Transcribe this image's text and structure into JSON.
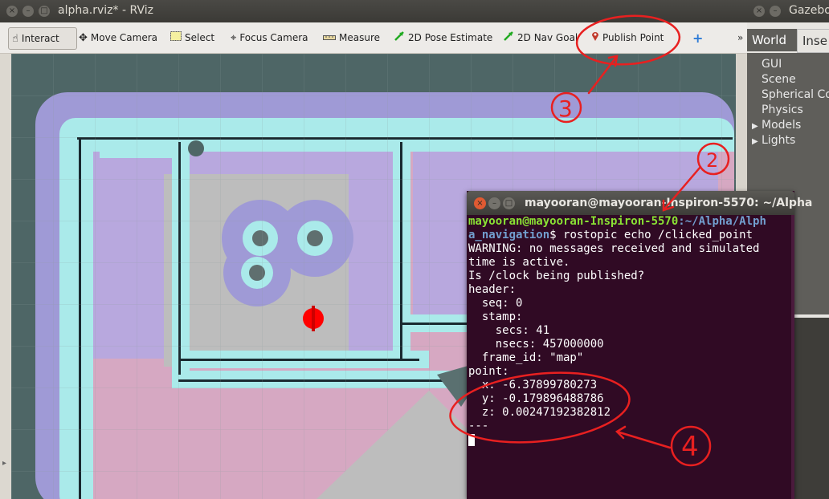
{
  "rviz": {
    "title": "alpha.rviz* - RViz",
    "toolbar": [
      {
        "label": "Interact",
        "icon": "hand-pointer-icon",
        "active": true
      },
      {
        "label": "Move Camera",
        "icon": "move-camera-icon"
      },
      {
        "label": "Select",
        "icon": "select-rectangle-icon"
      },
      {
        "label": "Focus Camera",
        "icon": "focus-camera-icon"
      },
      {
        "label": "Measure",
        "icon": "ruler-icon"
      },
      {
        "label": "2D Pose Estimate",
        "icon": "green-arrow-icon"
      },
      {
        "label": "2D Nav Goal",
        "icon": "green-arrow-icon"
      },
      {
        "label": "Publish Point",
        "icon": "map-pin-icon"
      }
    ],
    "add_tool_icon": "plus-icon",
    "more_label": "»"
  },
  "gazebo": {
    "title": "Gazebo",
    "tabs": [
      "World",
      "Inse"
    ],
    "tree": [
      "GUI",
      "Scene",
      "Spherical Co",
      "Physics",
      "Models",
      "Lights"
    ]
  },
  "terminal": {
    "title": "mayooran@mayooran-Inspiron-5570: ~/Alpha",
    "prompt_user": "mayooran@mayooran-Inspiron-5570",
    "prompt_path_1": ":~/Alpha/Alph",
    "prompt_path_2": "a_navigation",
    "command": "$ rostopic echo /clicked_point",
    "lines": [
      "WARNING: no messages received and simulated",
      "time is active.",
      "Is /clock being published?",
      "header:",
      "  seq: 0",
      "  stamp:",
      "    secs: 41",
      "    nsecs: 457000000",
      "  frame_id: \"map\"",
      "point:",
      "  x: -6.37899780273",
      "  y: -0.179896488786",
      "  z: 0.00247192382812",
      "---"
    ]
  },
  "annotations": {
    "labels": [
      "3",
      "2",
      "4"
    ],
    "color": "#e82020"
  },
  "colors": {
    "map_background": "#4e6666",
    "costmap_lavender": "#9f9ad6",
    "costmap_cyan": "#aaeaea",
    "obstacle_dark": "#1a2a30",
    "free_grey": "#bcbcbc",
    "marker_red": "#ff0000",
    "terminal_bg": "#300a24"
  }
}
